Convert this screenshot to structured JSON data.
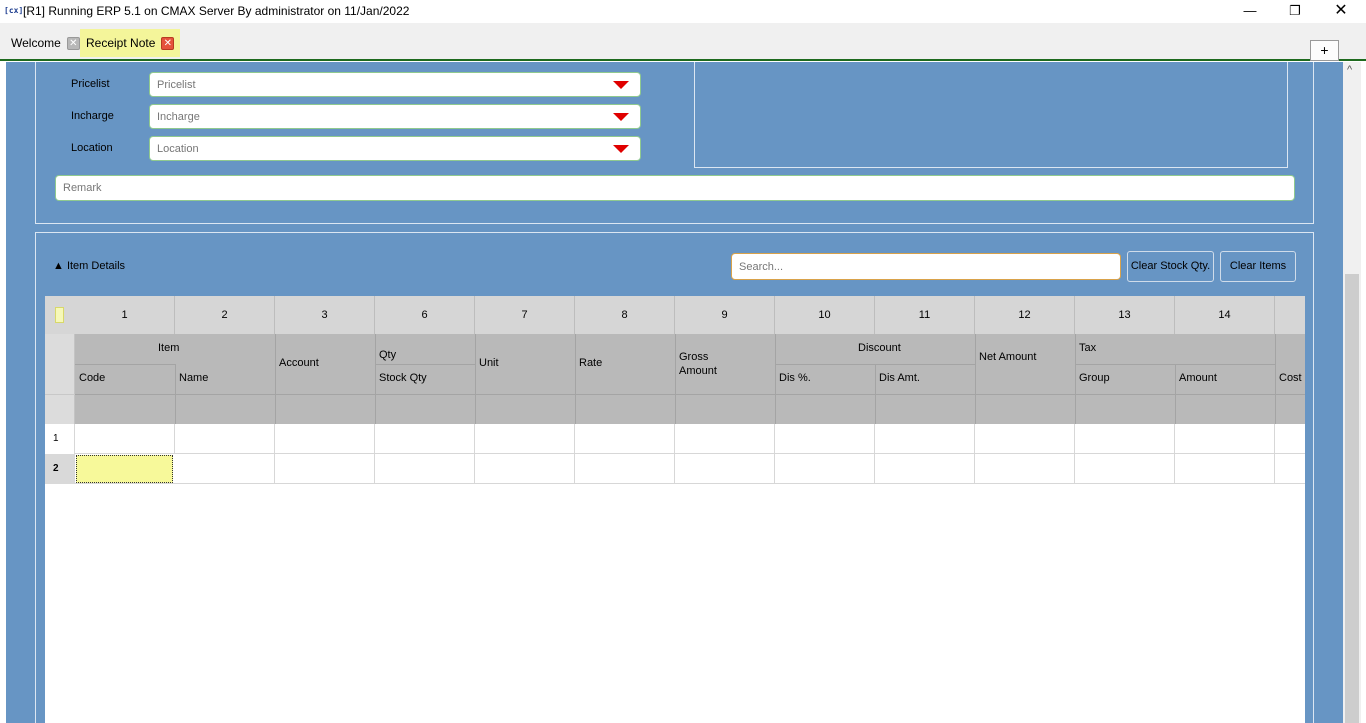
{
  "window": {
    "app_icon": "[cx]",
    "title": "[R1] Running ERP 5.1 on CMAX Server By administrator on 11/Jan/2022",
    "minimize": "—",
    "maximize": "❐",
    "close": "✕"
  },
  "tabs": [
    {
      "label": "Welcome",
      "close": "✕"
    },
    {
      "label": "Receipt Note",
      "close": "✕"
    }
  ],
  "tab_add": "+",
  "form": {
    "pricelist": {
      "label": "Pricelist",
      "placeholder": "Pricelist"
    },
    "incharge": {
      "label": "Incharge",
      "placeholder": "Incharge"
    },
    "location": {
      "label": "Location",
      "placeholder": "Location"
    },
    "remark_placeholder": "Remark"
  },
  "items": {
    "title": "▲ Item Details",
    "search_placeholder": "Search...",
    "clear_stock_label": "Clear Stock Qty.",
    "clear_items_label": "Clear Items"
  },
  "grid": {
    "column_numbers": [
      "1",
      "2",
      "3",
      "6",
      "7",
      "8",
      "9",
      "10",
      "11",
      "12",
      "13",
      "14"
    ],
    "headers": {
      "item": "Item",
      "code": "Code",
      "name": "Name",
      "account": "Account",
      "qty": "Qty",
      "stock_qty": "Stock Qty",
      "unit": "Unit",
      "rate": "Rate",
      "gross_amount": "Gross Amount",
      "discount": "Discount",
      "dis_pct": "Dis %.",
      "dis_amt": "Dis Amt.",
      "net_amount": "Net Amount",
      "tax": "Tax",
      "group": "Group",
      "amount": "Amount",
      "cost": "Cost"
    },
    "rows": [
      "1",
      "2"
    ],
    "active_row": "2"
  },
  "scroll_up": "^"
}
